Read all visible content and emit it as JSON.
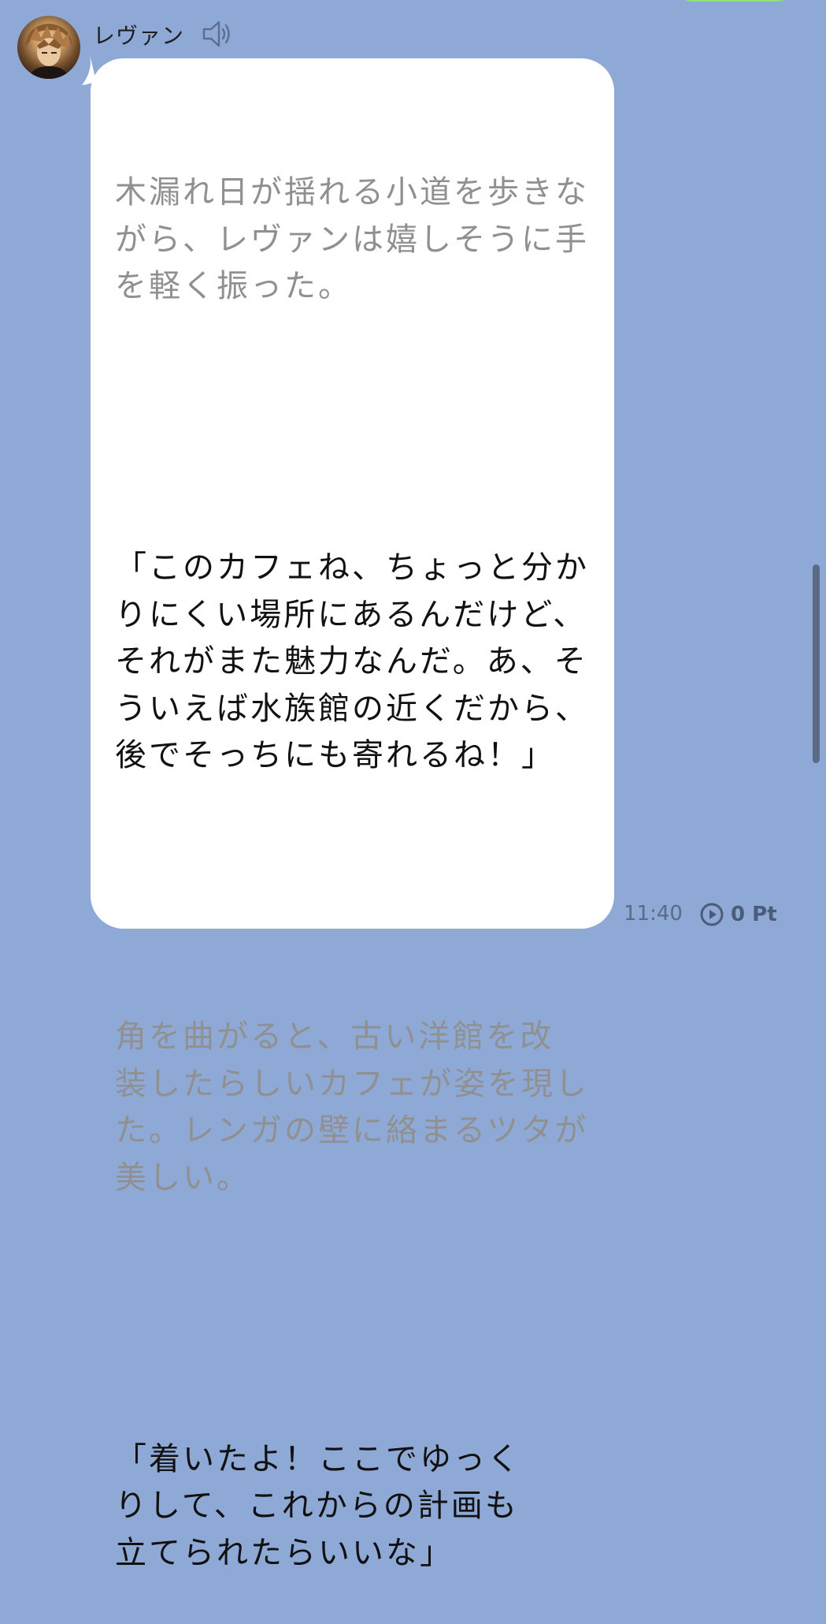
{
  "colors": {
    "background": "#8fa9d6",
    "bubble": "#ffffff",
    "narration_text": "#909090",
    "dialogue_text": "#111111",
    "own_bubble": "#92e07a"
  },
  "message": {
    "sender": "レヴァン",
    "paragraphs": [
      {
        "type": "narration",
        "text": "木漏れ日が揺れる小道を歩きな\nがら、レヴァンは嬉しそうに手\nを軽く振った。"
      },
      {
        "type": "dialogue",
        "text": "「このカフェね、ちょっと分か\nりにくい場所にあるんだけど、\nそれがまた魅力なんだ。あ、そ\nういえば水族館の近くだから、\n後でそっちにも寄れるね！」"
      },
      {
        "type": "narration",
        "text": "角を曲がると、古い洋館を改\n装したらしいカフェが姿を現し\nた。レンガの壁に絡まるツタが\n美しい。"
      },
      {
        "type": "dialogue",
        "text": "「着いたよ！ここでゆっく\nりして、これからの計画も\n立てられたらいいな」"
      }
    ],
    "time": "11:40",
    "points": "0 Pt"
  },
  "icons": {
    "speaker": "speaker-icon",
    "play": "play-circle-icon",
    "avatar": "character-avatar"
  }
}
